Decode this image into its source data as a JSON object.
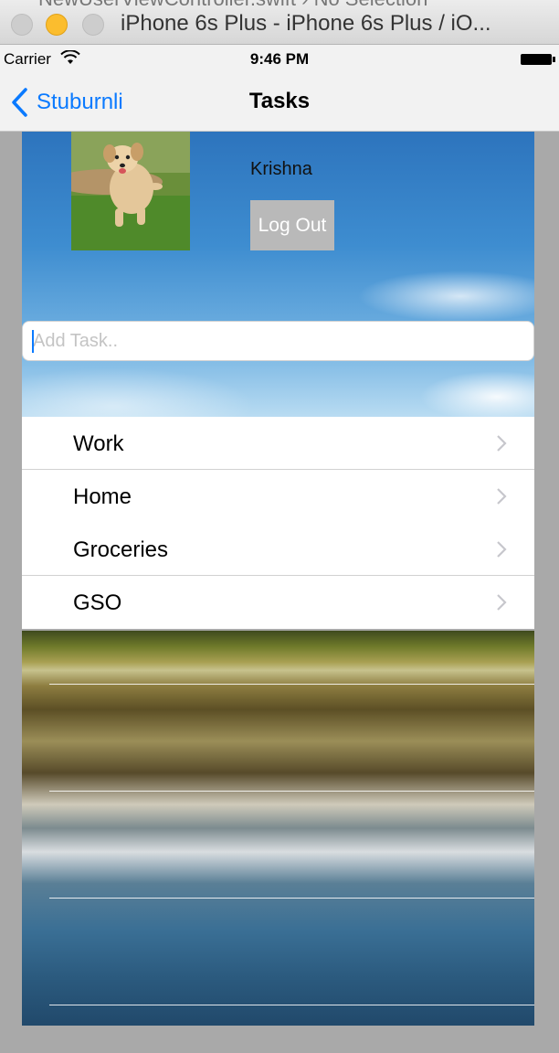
{
  "window": {
    "background_file_text": "NewUserViewController.swift  ›  No Selection",
    "title": "iPhone 6s Plus - iPhone 6s Plus / iO..."
  },
  "status_bar": {
    "carrier": "Carrier",
    "time": "9:46 PM"
  },
  "nav": {
    "back_label": "Stuburnli",
    "title": "Tasks"
  },
  "profile": {
    "name": "Krishna",
    "logout_label": "Log Out"
  },
  "task_input": {
    "placeholder": "Add Task..",
    "value": ""
  },
  "task_lists": [
    {
      "label": "Work"
    },
    {
      "label": "Home"
    },
    {
      "label": "Groceries"
    },
    {
      "label": "GSO"
    }
  ],
  "colors": {
    "accent": "#0a7aff",
    "logout_bg": "#b9b9b9"
  }
}
